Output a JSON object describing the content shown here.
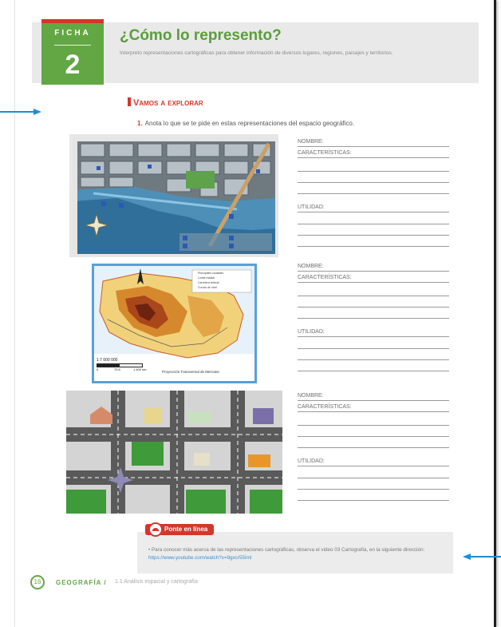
{
  "header": {
    "ficha_label": "FICHA",
    "ficha_number": "2",
    "title": "¿Cómo lo represento?",
    "subtitle": "Interpreto representaciones cartográficas para obtener información de diversos lugares, regiones, paisajes y territorios."
  },
  "section": {
    "heading": "Vamos a explorar",
    "number": "1.",
    "instruction": "Anota lo que se te pide en estas representaciones del espacio geográfico."
  },
  "fields": {
    "nombre": "NOMBRE:",
    "caracteristicas": "CARACTERÍSTICAS:",
    "utilidad": "UTILIDAD:"
  },
  "map2": {
    "legend": [
      "Principales ciudades",
      "Límite estatal",
      "Carretera federal",
      "Curvas de nivel"
    ],
    "scale": "1:7 000 000",
    "scale_ticks": [
      "0",
      "70.5",
      "1 400 km"
    ],
    "projection": "Proyección Transversal de Mercator"
  },
  "online": {
    "badge": "Ponte en línea",
    "text": "Para conocer más acerca de las representaciones cartográficas, observa el video 03 Cartografía, en la siguiente dirección:",
    "url": "https://www.youtube.com/watch?v=9gxcr55Iml"
  },
  "footer": {
    "page_number": "16",
    "subject": "GEOGRAFÍA /",
    "unit": "1.1 Análisis espacial y cartografía"
  },
  "colors": {
    "accent_green": "#62a744",
    "accent_red": "#d5362b",
    "arrow_blue": "#1f8ed0"
  },
  "icons": [
    "arrow-right-icon",
    "arrow-left-icon",
    "compass-rose-icon",
    "online-icon"
  ]
}
